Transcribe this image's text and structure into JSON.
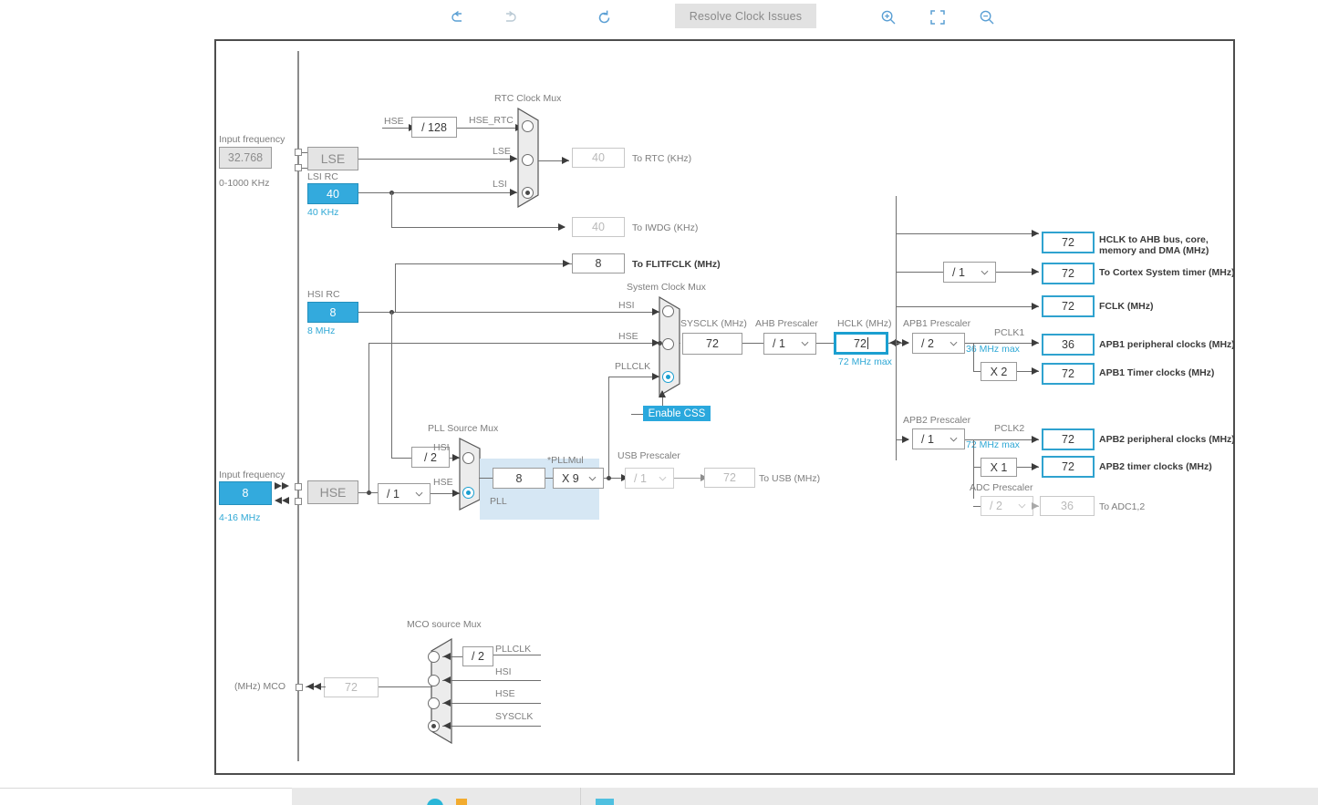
{
  "toolbar": {
    "undo": "undo-icon",
    "redo": "redo-icon",
    "refresh": "refresh-icon",
    "resolve_label": "Resolve Clock Issues",
    "zoom_in": "zoom-in-icon",
    "fit": "fit-screen-icon",
    "zoom_out": "zoom-out-icon"
  },
  "lse": {
    "input_frequency_label": "Input frequency",
    "input_frequency_value": "32.768",
    "range": "0-1000 KHz",
    "block_label": "LSE"
  },
  "lsi": {
    "title": "LSI RC",
    "value": "40",
    "unit": "40 KHz"
  },
  "hsi": {
    "title": "HSI RC",
    "value": "8",
    "unit": "8 MHz"
  },
  "hse": {
    "input_frequency_label": "Input frequency",
    "input_frequency_value": "8",
    "range": "4-16 MHz",
    "block_label": "HSE",
    "prescaler": "/ 1"
  },
  "rtc_mux": {
    "title": "RTC Clock Mux",
    "hse_label": "HSE",
    "div128": "/ 128",
    "inputs": [
      "HSE_RTC",
      "LSE",
      "LSI"
    ],
    "selected": 2
  },
  "outputs_left": [
    {
      "name": "to-rtc",
      "value": "40",
      "label": "To RTC (KHz)",
      "state": "disabled"
    },
    {
      "name": "to-iwdg",
      "value": "40",
      "label": "To IWDG (KHz)",
      "state": "disabled"
    },
    {
      "name": "to-flitfclk",
      "value": "8",
      "label": "To FLITFCLK (MHz)",
      "state": "active"
    }
  ],
  "system_clock_mux": {
    "title": "System Clock Mux",
    "inputs": [
      "HSI",
      "HSE",
      "PLLCLK"
    ],
    "selected": 2,
    "css_button": "Enable CSS"
  },
  "pll_source_mux": {
    "title": "PLL Source Mux",
    "hsi_div": "/ 2",
    "inputs": [
      "HSI",
      "HSE"
    ],
    "selected": 1
  },
  "pll": {
    "region_label": "PLL",
    "input_value": "8",
    "mul_label": "*PLLMul",
    "mul_value": "X 9"
  },
  "usb": {
    "prescaler_label": "USB Prescaler",
    "prescaler_value": "/ 1",
    "out_value": "72",
    "out_label": "To USB (MHz)"
  },
  "chain": {
    "sysclk_label": "SYSCLK (MHz)",
    "sysclk_value": "72",
    "ahb_prescaler_label": "AHB Prescaler",
    "ahb_prescaler_value": "/ 1",
    "hclk_label": "HCLK (MHz)",
    "hclk_value": "72",
    "hclk_max": "72 MHz max"
  },
  "ahb_outputs": [
    {
      "name": "hclk-ahb-bus",
      "value": "72",
      "label": "HCLK to AHB bus, core,\nmemory and DMA (MHz)"
    },
    {
      "name": "cortex-system-timer",
      "value": "72",
      "label": "To Cortex System timer (MHz)",
      "prescaler": "/ 1"
    },
    {
      "name": "fclk",
      "value": "72",
      "label": "FCLK (MHz)"
    }
  ],
  "apb1": {
    "prescaler_label": "APB1 Prescaler",
    "prescaler_value": "/ 2",
    "pclk_label": "PCLK1",
    "max_label": "36 MHz max",
    "periph_value": "36",
    "periph_label": "APB1 peripheral clocks (MHz)",
    "timer_mul": "X 2",
    "timer_value": "72",
    "timer_label": "APB1 Timer clocks (MHz)"
  },
  "apb2": {
    "prescaler_label": "APB2 Prescaler",
    "prescaler_value": "/ 1",
    "pclk_label": "PCLK2",
    "max_label": "72 MHz max",
    "periph_value": "72",
    "periph_label": "APB2 peripheral clocks (MHz)",
    "timer_mul": "X 1",
    "timer_value": "72",
    "timer_label": "APB2 timer clocks (MHz)",
    "adc_prescaler_label": "ADC Prescaler",
    "adc_prescaler_value": "/ 2",
    "adc_value": "36",
    "adc_label": "To ADC1,2"
  },
  "mco": {
    "title": "MCO source Mux",
    "div2": "/ 2",
    "inputs": [
      "PLLCLK",
      "HSI",
      "HSE",
      "SYSCLK"
    ],
    "selected": 3,
    "out_value": "72",
    "out_label": "(MHz) MCO"
  },
  "colors": {
    "accent": "#33aadd",
    "accent_border": "#2fa2cf",
    "wire": "#6f6f6f",
    "label": "#7d7d7d",
    "pll_region": "#d6e7f4"
  }
}
